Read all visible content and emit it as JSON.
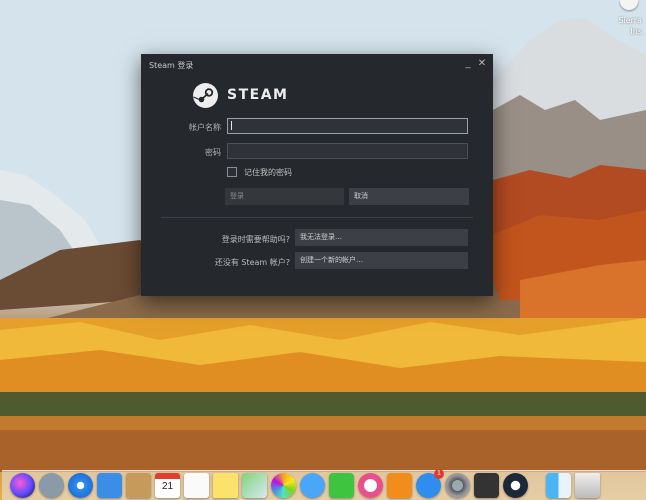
{
  "desktop": {
    "label_line1": "Sierra",
    "label_line2": "Ins"
  },
  "window": {
    "title": "Steam 登录",
    "minimize_glyph": "_",
    "close_glyph": "✕"
  },
  "logo": {
    "text": "STEAM"
  },
  "form": {
    "account_label": "帐户名称",
    "account_value": "",
    "password_label": "密码",
    "password_value": "",
    "remember_label": "记住我的密码",
    "remember_checked": false,
    "login_button": "登录",
    "cancel_button": "取消"
  },
  "help": {
    "need_help_label": "登录时需要帮助吗?",
    "cant_login_button": "我无法登录…",
    "no_account_label": "还没有 Steam 帐户?",
    "create_account_button": "创建一个新的帐户…"
  },
  "dock": {
    "items": [
      "siri-icon",
      "launchpad-icon",
      "safari-icon",
      "mail-icon",
      "notes-icon",
      "calendar-icon",
      "reminders-icon",
      "stickies-icon",
      "maps-icon",
      "photos-icon",
      "messages-icon",
      "facetime-icon",
      "music-icon",
      "books-icon",
      "app-store-icon",
      "system-preferences-icon",
      "unity-icon",
      "steam-icon",
      "finder-icon",
      "trash-icon"
    ],
    "calendar_day": "21",
    "calendar_month": "JUL",
    "app_store_badge": "1"
  }
}
